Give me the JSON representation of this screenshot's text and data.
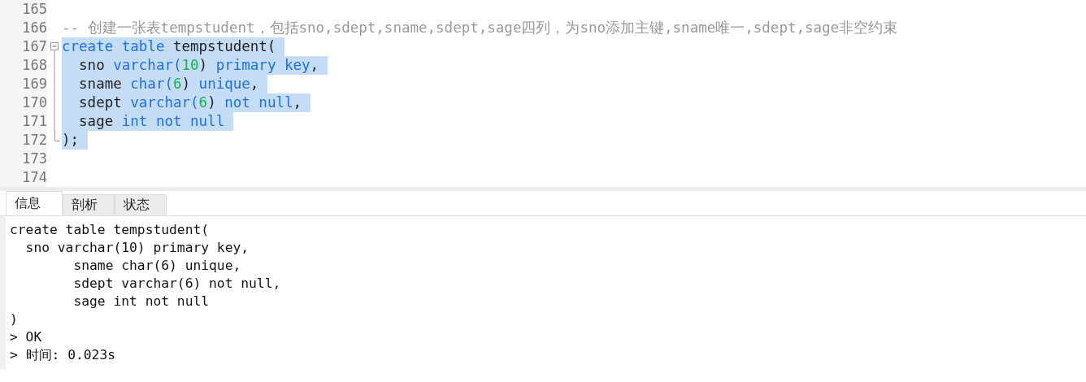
{
  "editor": {
    "lines": [
      {
        "number": "165",
        "kind": "code"
      },
      {
        "number": "166",
        "kind": "code",
        "selected": false,
        "tokens": [
          {
            "text": "-- 创建一张表tempstudent，包括sno,sdept,sname,sdept,sage四列，为sno添加主键,sname唯一,sdept,sage非空约束",
            "kind": "comment"
          }
        ]
      },
      {
        "number": "167",
        "kind": "foldstart",
        "selected": true,
        "tokens": [
          {
            "text": "create table",
            "kind": "keyword"
          },
          {
            "text": " tempstudent(",
            "kind": "plain"
          }
        ]
      },
      {
        "number": "168",
        "kind": "foldbody",
        "selected": true,
        "tokens": [
          {
            "text": "  sno ",
            "kind": "plain"
          },
          {
            "text": "varchar(",
            "kind": "keyword"
          },
          {
            "text": "10",
            "kind": "number"
          },
          {
            "text": ") ",
            "kind": "plain"
          },
          {
            "text": "primary key",
            "kind": "keyword"
          },
          {
            "text": ",",
            "kind": "plain"
          }
        ]
      },
      {
        "number": "169",
        "kind": "foldbody",
        "selected": true,
        "tokens": [
          {
            "text": "  sname ",
            "kind": "plain"
          },
          {
            "text": "char(",
            "kind": "keyword"
          },
          {
            "text": "6",
            "kind": "number"
          },
          {
            "text": ") ",
            "kind": "plain"
          },
          {
            "text": "unique",
            "kind": "keyword"
          },
          {
            "text": ",",
            "kind": "plain"
          }
        ]
      },
      {
        "number": "170",
        "kind": "foldbody",
        "selected": true,
        "tokens": [
          {
            "text": "  sdept ",
            "kind": "plain"
          },
          {
            "text": "varchar(",
            "kind": "keyword"
          },
          {
            "text": "6",
            "kind": "number"
          },
          {
            "text": ") ",
            "kind": "plain"
          },
          {
            "text": "not null",
            "kind": "keyword"
          },
          {
            "text": ",",
            "kind": "plain"
          }
        ]
      },
      {
        "number": "171",
        "kind": "foldbody",
        "selected": true,
        "tokens": [
          {
            "text": "  sage ",
            "kind": "plain"
          },
          {
            "text": "int not null",
            "kind": "keyword"
          }
        ]
      },
      {
        "number": "172",
        "kind": "foldend",
        "selected": true,
        "tokens": [
          {
            "text": ");",
            "kind": "plain"
          }
        ]
      },
      {
        "number": "173",
        "kind": "code"
      },
      {
        "number": "174",
        "kind": "code"
      }
    ]
  },
  "tabs": [
    {
      "label": "信息",
      "selected": true
    },
    {
      "label": "剖析",
      "selected": false
    },
    {
      "label": "状态",
      "selected": false
    }
  ],
  "output": {
    "lines": [
      "create table tempstudent(",
      "  sno varchar(10) primary key,",
      "        sname char(6) unique,",
      "        sdept varchar(6) not null,",
      "        sage int not null",
      ")",
      "> OK",
      "> 时间: 0.023s"
    ]
  }
}
